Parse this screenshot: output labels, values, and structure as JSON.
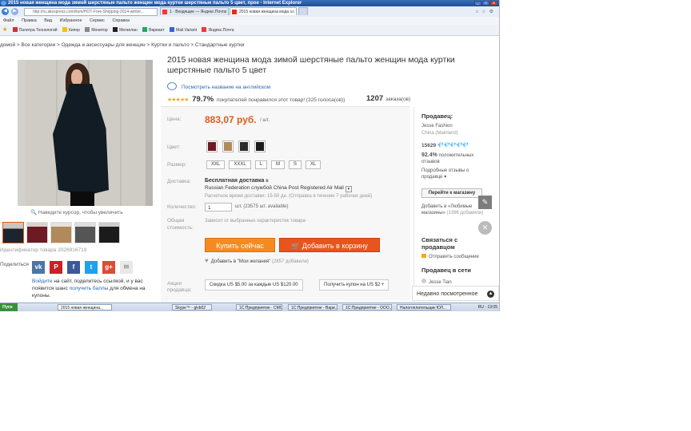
{
  "browser": {
    "window_title": "2015 новая женщина мода зимой шерстяные пальто женщин мода куртки шерстяные пальто 5 цвет, прое - Internet Explorer",
    "url": "http://ru.aliexpress.com/item/HOT-Free-Shipping-2014-winter...",
    "tabs": [
      {
        "label": "1 · Входящие — Яндекс.Почта"
      },
      {
        "label": "2015 новая женщина мода з..."
      }
    ],
    "menu": [
      "Файл",
      "Правка",
      "Вид",
      "Избранное",
      "Сервис",
      "Справка"
    ],
    "favorites": [
      "Палитра Технологий",
      "Кипер",
      "Монитор",
      "Мегаплан",
      "Вариант",
      "Mail.Variant",
      "Яндекс.Почта"
    ]
  },
  "page": {
    "breadcrumb": "домой > Все категории > Одежда и аксессуары для женщин > Куртки и пальто > Стандартные куртки",
    "title": "2015 новая женщина мода зимой шерстяные пальто женщин мода куртки шерстяные пальто 5 цвет",
    "translate_link": "Посмотреть название на английском",
    "rating": {
      "stars": "★★★★★",
      "percent": "79.7%",
      "text": "покупателей понравился этот товар! (325 голоса(ов))"
    },
    "orders": {
      "count": "1207",
      "label": "заказа(ов)"
    },
    "hover_hint": "Наведите курсор, чтобы увеличить",
    "product_id": "Идентификатор товара 2026916719",
    "share_label": "Поделиться",
    "share_icons": [
      "vk",
      "pinterest",
      "facebook",
      "twitter",
      "google-plus",
      "email"
    ],
    "refer_text": {
      "link1": "Войдите",
      "text1": " на сайт, поделитесь ссылкой, и у вас появится шанс ",
      "link2": "получить баллы",
      "text2": " для обмена на купоны."
    }
  },
  "pricebox": {
    "price_label": "Цена:",
    "price": "883,07 руб.",
    "per_unit": "/ шт.",
    "color_label": "Цвет:",
    "colors": [
      "#6e1a22",
      "#b08a5a",
      "#2a2a2a",
      "#1b1b1b"
    ],
    "size_label": "Размер:",
    "sizes": [
      "XXL",
      "XXXL",
      "L",
      "M",
      "S",
      "XL"
    ],
    "delivery_label": "Доставка:",
    "delivery_free": "Бесплатная доставка",
    "delivery_to": "в",
    "delivery_service": "Russian Federation службой China Post Registered Air Mail",
    "delivery_time": "Расчетное время доставки: 15-50 дн. (Отправка в течение 7 рабочих дней)",
    "qty_label": "Количество:",
    "qty_value": "1",
    "qty_available": "шт. (23575 шт. available)",
    "total_label1": "Общая",
    "total_label2": "стоимость:",
    "total_text": "Зависит от выбранных характеристик товара",
    "buy_button": "Купить сейчас",
    "cart_button": "Добавить в корзину",
    "wishlist": "Добавить в \"Мои желания\"",
    "wishlist_count": "(2857 добавили)",
    "promo_label1": "Акция",
    "promo_label2": "продавца:",
    "coupon1": "Скидка US $5.00 за каждые US $120.00",
    "coupon2": "Получить купон на US $2 +"
  },
  "seller": {
    "heading": "Продавец:",
    "name": "Jesse Fashion",
    "location": "China (Mainland)",
    "score": "15629",
    "diamonds": "💎💎💎💎💎",
    "positive_pct": "92.4%",
    "positive_text": "положительных",
    "positive_text2": "отзывов",
    "detailed_reviews": "Подробные отзывы о",
    "detailed_reviews2": "продавце",
    "store_button": "Перейти к магазину",
    "fav_store": "Добавить в «Любимые",
    "fav_store2": "магазины»",
    "fav_store_count": "(1396 добавили)",
    "contact_heading": "Связаться с",
    "contact_heading2": "продавцом",
    "message": "Отправить сообщение",
    "online_heading": "Продавец в сети",
    "online_name": "Jesse Tian"
  },
  "recently_viewed": "Недавно посмотренное",
  "taskbar": {
    "start": "Пуск",
    "items": [
      "2015 новая женщина...",
      "Skype™ - glvb02",
      "1С:Предприятие - СМС...",
      "1С:Предприятие - Вари...",
      "1С:Предприятие - ООО...",
      "Налогоплательщик ЮЛ..."
    ],
    "tray_lang": "RU",
    "time": "13:05"
  }
}
